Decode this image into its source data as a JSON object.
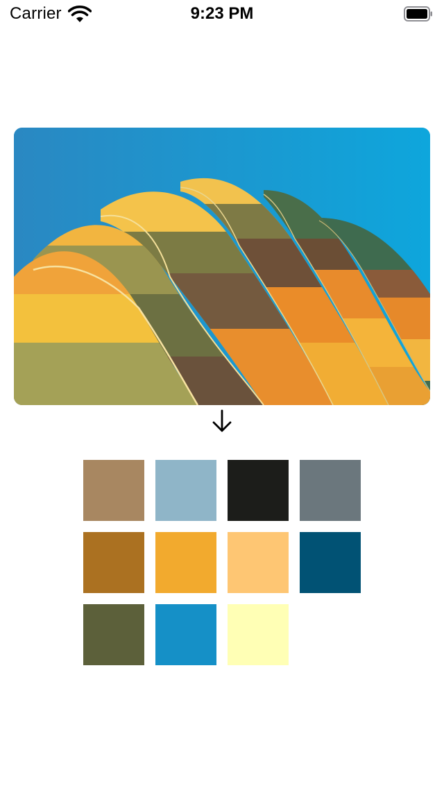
{
  "status_bar": {
    "carrier": "Carrier",
    "time": "9:23 PM",
    "wifi_icon": "wifi-icon",
    "battery_icon": "battery-icon"
  },
  "photo": {
    "subject": "hot-air-balloon",
    "icon": "photo"
  },
  "arrow_icon": "arrow-down-icon",
  "palette": {
    "colors": [
      "#a88761",
      "#8fb5c8",
      "#1c1d1a",
      "#6b777d",
      "#ab7121",
      "#f2aa2e",
      "#fec673",
      "#015274",
      "#5c603a",
      "#1590c7",
      "#ffffb5"
    ]
  }
}
